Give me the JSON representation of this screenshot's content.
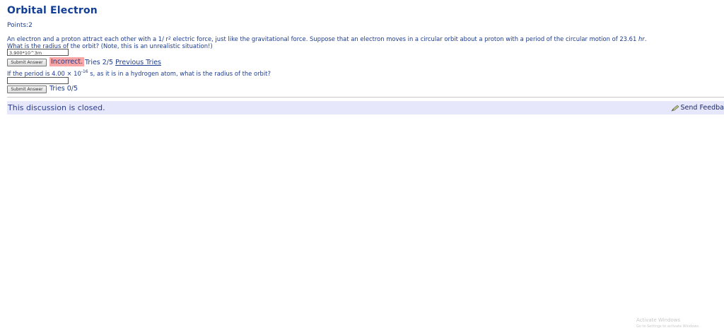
{
  "problem": {
    "title": "Orbital Electron",
    "points": "Points:2",
    "statement_line1_a": "An electron and a proton attract each other with a 1/ r",
    "statement_sup": "2",
    "statement_line1_b": " electric force, just like the gravitational force. Suppose that an electron moves in a circular orbit about a proton with a period of the circular motion of 23.61 ",
    "statement_unit": "hr",
    "statement_line1_end": ".",
    "statement_line2_link": "What is the radius",
    "statement_line2_rest": " of the orbit? (Note, this is an unrealistic situation!)"
  },
  "part1": {
    "answer_value": "3.900*10^3m",
    "submit_label": "Submit Answer",
    "feedback": "Incorrect.",
    "tries": "Tries 2/5",
    "previous_tries": "Previous Tries"
  },
  "part2": {
    "question_a": "If the period is 4.00 × 10",
    "question_exp": "-16",
    "question_b": " s, as it is in a hydrogen atom, what is the radius of the orbit?",
    "answer_value": "",
    "submit_label": "Submit Answer",
    "tries": "Tries 0/5"
  },
  "discussion": {
    "closed_text": "This discussion is closed.",
    "send_feedback": "Send Feedba"
  },
  "watermark": {
    "line1": "Activate Windows",
    "line2": "Go to Settings to activate Windows."
  },
  "icons": {
    "feedback": "pen-icon"
  },
  "colors": {
    "incorrect_bg": "#f7a5a5",
    "discussion_bar": "#e6e7fb",
    "title": "#133e94"
  }
}
